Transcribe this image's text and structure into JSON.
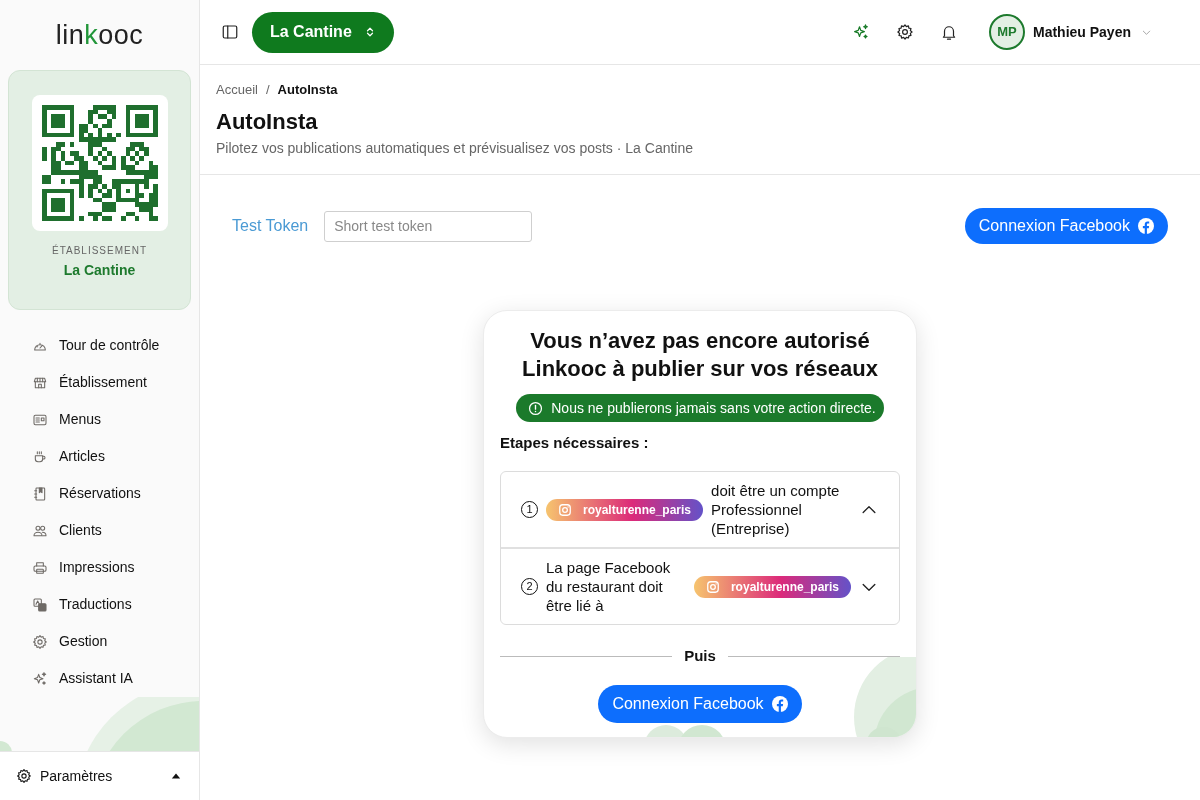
{
  "sidebar": {
    "logo": [
      {
        "text": "lin",
        "accent": false
      },
      {
        "text": "k",
        "accent": true
      },
      {
        "text": "ooc",
        "accent": false
      }
    ],
    "establishment_card": {
      "label": "ÉTABLISSEMENT",
      "name": "La Cantine"
    },
    "nav_items": [
      {
        "label": "Tour de contrôle",
        "selected": false
      },
      {
        "label": "Établissement",
        "selected": false
      },
      {
        "label": "Menus",
        "selected": false
      },
      {
        "label": "Articles",
        "selected": false
      },
      {
        "label": "Réservations",
        "selected": false
      },
      {
        "label": "Clients",
        "selected": false
      },
      {
        "label": "Impressions",
        "selected": false
      },
      {
        "label": "Traductions",
        "selected": false
      },
      {
        "label": "Gestion",
        "selected": false
      },
      {
        "label": "Assistant IA",
        "selected": false
      }
    ],
    "footer": {
      "label": "Paramètres"
    }
  },
  "topbar": {
    "establishment_button": "La Cantine",
    "user": {
      "initials": "MP",
      "name": "Mathieu Payen"
    }
  },
  "page_header": {
    "breadcrumb": [
      {
        "label": "Accueil",
        "current": false
      },
      {
        "label": "AutoInsta",
        "current": true
      }
    ],
    "breadcrumb_separator": "/",
    "title": "AutoInsta",
    "subtitle": "Pilotez vos publications automatiques et prévisualisez vos posts · La Cantine"
  },
  "token_bar": {
    "label": "Test Token",
    "placeholder": "Short test token",
    "connect_button": "Connexion Facebook"
  },
  "auth_card": {
    "title": "Vous n’avez pas encore autorisé Linkooc à publier sur vos réseaux",
    "notice": "Nous ne publierons jamais sans votre action directe.",
    "steps_heading": "Etapes nécessaires :",
    "steps": [
      {
        "number": "1",
        "expanded": true,
        "parts": [
          {
            "kind": "account",
            "handle": "royalturenne_paris"
          },
          {
            "kind": "text",
            "text": "doit être un compte Professionnel (Entreprise)"
          }
        ]
      },
      {
        "number": "2",
        "expanded": false,
        "parts": [
          {
            "kind": "text",
            "text": "La page Facebook du restaurant doit être lié à"
          },
          {
            "kind": "account",
            "handle": "royalturenne_paris"
          }
        ]
      }
    ],
    "divider": "Puis",
    "connect_button": "Connexion Facebook"
  }
}
